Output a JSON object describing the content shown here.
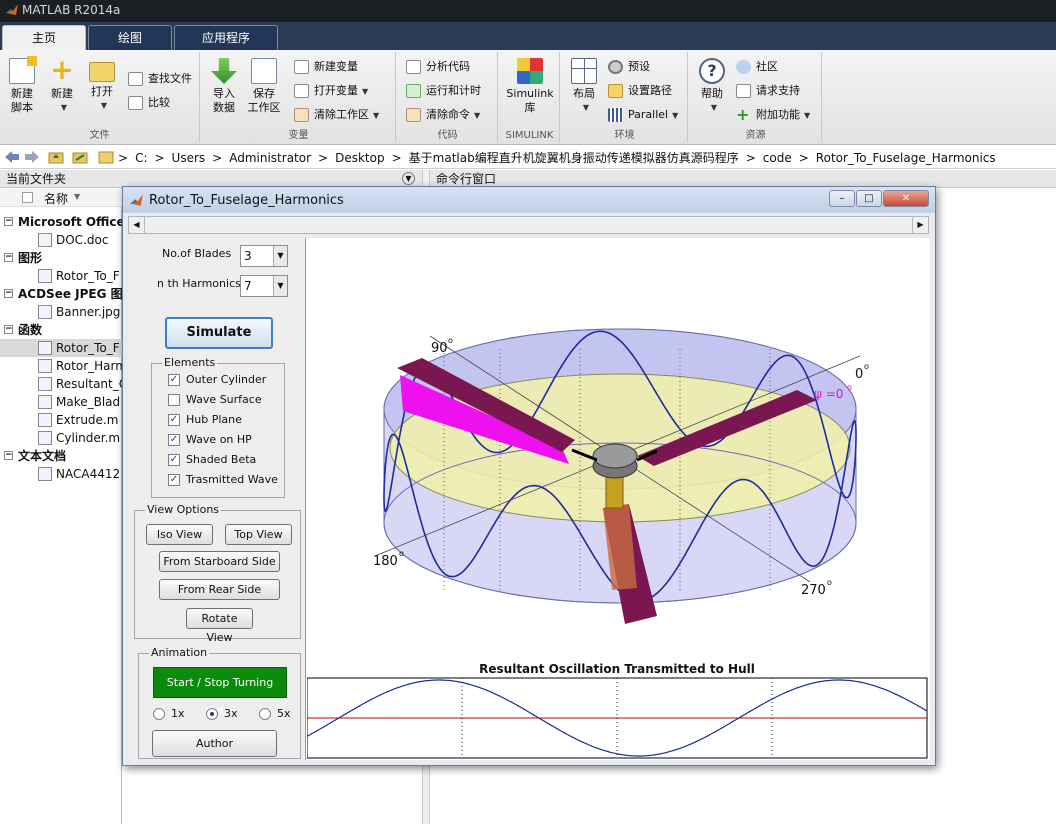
{
  "app": {
    "title": "MATLAB R2014a"
  },
  "tabs": [
    {
      "label": "主页",
      "active": true
    },
    {
      "label": "绘图",
      "active": false
    },
    {
      "label": "应用程序",
      "active": false
    }
  ],
  "ribbon": {
    "file": {
      "title": "文件",
      "new_script": "新建\n脚本",
      "new_script_l1": "新建",
      "new_script_l2": "脚本",
      "new": "新建",
      "open": "打开",
      "find_files": "查找文件",
      "compare": "比较"
    },
    "variable": {
      "title": "变量",
      "import_l1": "导入",
      "import_l2": "数据",
      "save_l1": "保存",
      "save_l2": "工作区",
      "new_var": "新建变量",
      "open_var": "打开变量",
      "clear_ws": "清除工作区"
    },
    "code": {
      "title": "代码",
      "analyze": "分析代码",
      "run_time": "运行和计时",
      "clear_cmd": "清除命令"
    },
    "simulink": {
      "title": "SIMULINK",
      "btn_l1": "Simulink",
      "btn_l2": "库"
    },
    "env": {
      "title": "环境",
      "layout": "布局",
      "prefs": "预设",
      "set_path": "设置路径",
      "parallel": "Parallel"
    },
    "resources": {
      "title": "资源",
      "help": "帮助",
      "community": "社区",
      "support": "请求支持",
      "addons": "附加功能"
    }
  },
  "address": {
    "segments": [
      "C:",
      "Users",
      "Administrator",
      "Desktop",
      "基于matlab编程直升机旋翼机身振动传递模拟器仿真源码程序",
      "code",
      "Rotor_To_Fuselage_Harmonics"
    ],
    "separator": ">"
  },
  "current_folder": {
    "header": "当前文件夹",
    "column": "名称",
    "items": [
      {
        "type": "section",
        "label": "Microsoft Office"
      },
      {
        "type": "file",
        "label": "DOC.doc"
      },
      {
        "type": "section",
        "label": "图形"
      },
      {
        "type": "file",
        "label": "Rotor_To_F"
      },
      {
        "type": "section",
        "label": "ACDSee JPEG 图像"
      },
      {
        "type": "file",
        "label": "Banner.jpg"
      },
      {
        "type": "section",
        "label": "函数"
      },
      {
        "type": "file",
        "label": "Rotor_To_F",
        "selected": true
      },
      {
        "type": "file",
        "label": "Rotor_Harm"
      },
      {
        "type": "file",
        "label": "Resultant_C"
      },
      {
        "type": "file",
        "label": "Make_Blad"
      },
      {
        "type": "file",
        "label": "Extrude.m"
      },
      {
        "type": "file",
        "label": "Cylinder.m"
      },
      {
        "type": "section",
        "label": "文本文档"
      },
      {
        "type": "file",
        "label": "NACA4412"
      }
    ]
  },
  "command_window": {
    "header": "命令行窗口"
  },
  "figure": {
    "title": "Rotor_To_Fuselage_Harmonics",
    "controls": {
      "blades_label": "No.of Blades",
      "blades_value": "3",
      "harmonics_label": "n th Harmonics",
      "harmonics_value": "7",
      "simulate": "Simulate",
      "elements_title": "Elements",
      "elements": [
        {
          "label": "Outer Cylinder",
          "checked": true
        },
        {
          "label": "Wave Surface",
          "checked": false
        },
        {
          "label": "Hub Plane",
          "checked": true
        },
        {
          "label": "Wave on HP",
          "checked": true
        },
        {
          "label": "Shaded Beta",
          "checked": true
        },
        {
          "label": "Trasmitted Wave",
          "checked": true
        }
      ],
      "view_title": "View Options",
      "iso_view": "Iso View",
      "top_view": "Top View",
      "starboard": "From Starboard Side",
      "rear": "From Rear Side",
      "rotate": "Rotate View",
      "animation_title": "Animation",
      "start_stop": "Start / Stop Turning Rotor",
      "speeds": [
        {
          "label": "1x",
          "selected": false
        },
        {
          "label": "3x",
          "selected": true
        },
        {
          "label": "5x",
          "selected": false
        }
      ],
      "author": "Author"
    },
    "plot3d": {
      "labels": {
        "a90": "90",
        "a0": "0",
        "a180": "180",
        "a270": "270",
        "psi": "ψ =0",
        "deg": "o"
      },
      "colors": {
        "cylinder": "#b8b8ee",
        "hub_plane": "#f2f2a8",
        "wave": "#1c2ca0",
        "blade": "#7a1650",
        "blade_shade": "#ee10ee"
      }
    },
    "hull_plot": {
      "title": "Resultant Oscillation Transmitted to Hull",
      "colors": {
        "wave": "#1a2a9c",
        "baseline": "#c80000"
      }
    }
  }
}
